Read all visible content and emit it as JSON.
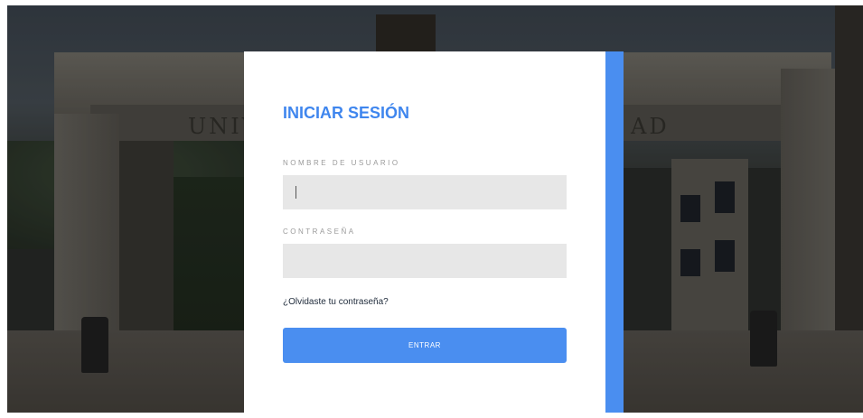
{
  "login": {
    "title": "INICIAR SESIÓN",
    "username_label": "NOMBRE DE USUARIO",
    "username_value": "",
    "password_label": "CONTRASEÑA",
    "password_value": "",
    "forgot_link": "¿Olvidaste tu contraseña?",
    "submit_label": "ENTRAR"
  },
  "background": {
    "gate_text_left": "UNIV",
    "gate_text_right": "AD"
  },
  "colors": {
    "accent": "#4a8ef0",
    "title": "#3f86ee",
    "input_bg": "#e7e7e7",
    "card_bg": "#ffffff"
  }
}
